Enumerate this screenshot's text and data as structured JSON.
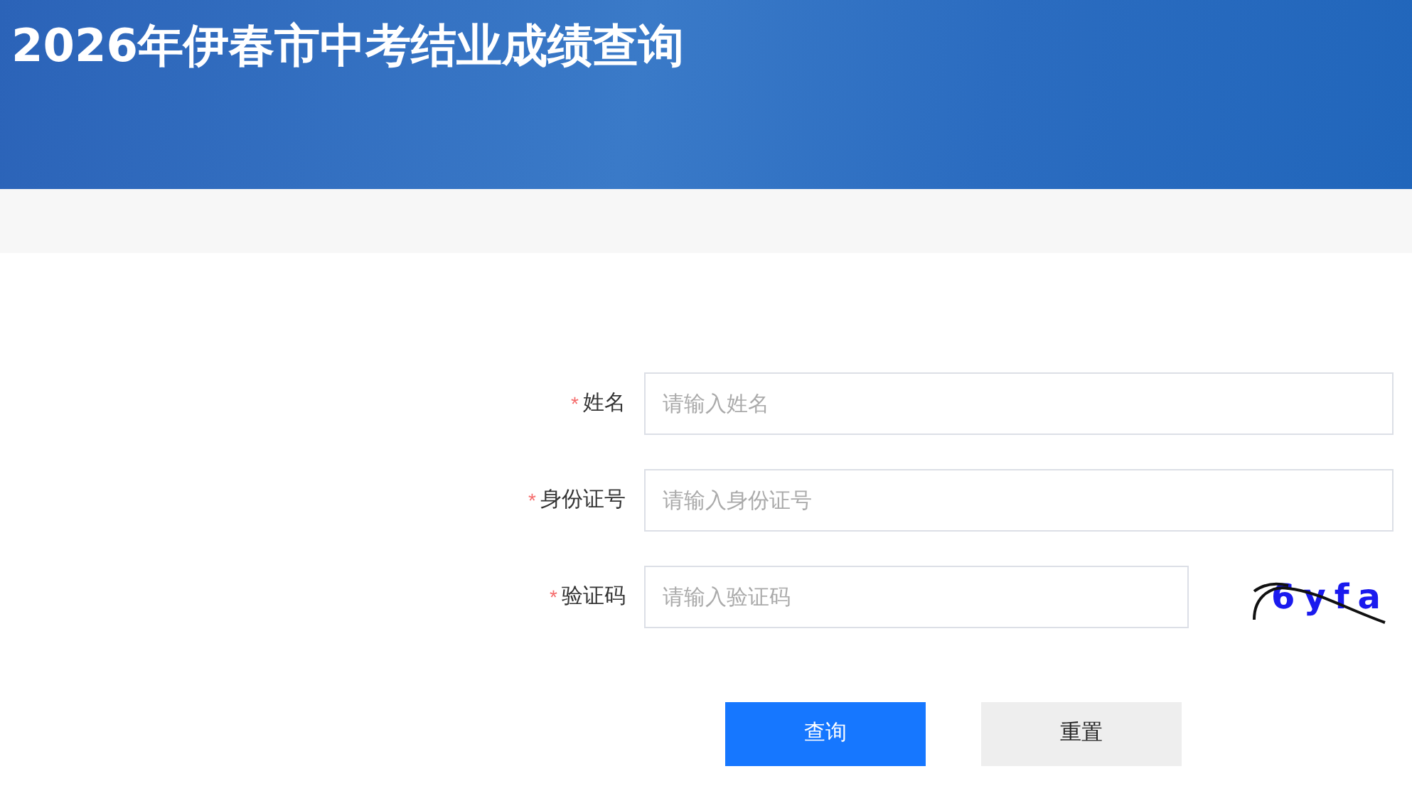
{
  "header": {
    "title": "2026年伊春市中考结业成绩查询"
  },
  "form": {
    "fields": [
      {
        "kind": "text",
        "required_mark": "*",
        "label": "姓名",
        "placeholder": "请输入姓名"
      },
      {
        "kind": "text",
        "required_mark": "*",
        "label": "身份证号",
        "placeholder": "请输入身份证号"
      },
      {
        "kind": "captcha",
        "required_mark": "*",
        "label": "验证码",
        "placeholder": "请输入验证码",
        "captcha": "6yfa"
      }
    ],
    "buttons": [
      {
        "kind": "primary",
        "label": "查询"
      },
      {
        "kind": "secondary",
        "label": "重置"
      }
    ]
  }
}
